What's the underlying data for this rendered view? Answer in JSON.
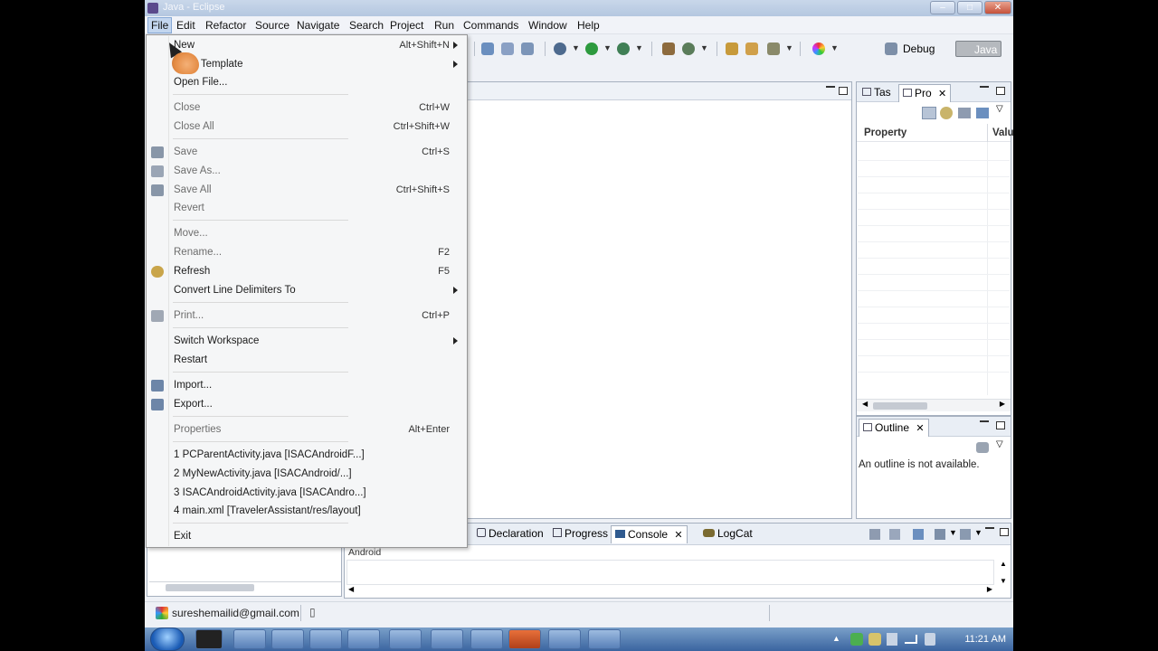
{
  "window": {
    "title": "Java - Eclipse"
  },
  "menubar": [
    "File",
    "Edit",
    "Refactor",
    "Source",
    "Navigate",
    "Search",
    "Project",
    "Run",
    "Commands",
    "Window",
    "Help"
  ],
  "perspectives": {
    "debug": "Debug",
    "java": "Java"
  },
  "file_menu": {
    "items": [
      {
        "label": "New",
        "shortcut": "Alt+Shift+N",
        "submenu": true
      },
      {
        "label": "From Template",
        "submenu": true
      },
      {
        "label": "Open File..."
      },
      {
        "label": "Close",
        "shortcut": "Ctrl+W"
      },
      {
        "label": "Close All",
        "shortcut": "Ctrl+Shift+W"
      },
      {
        "label": "Save",
        "shortcut": "Ctrl+S"
      },
      {
        "label": "Save As..."
      },
      {
        "label": "Save All",
        "shortcut": "Ctrl+Shift+S"
      },
      {
        "label": "Revert"
      },
      {
        "label": "Move..."
      },
      {
        "label": "Rename...",
        "shortcut": "F2"
      },
      {
        "label": "Refresh",
        "shortcut": "F5"
      },
      {
        "label": "Convert Line Delimiters To",
        "submenu": true
      },
      {
        "label": "Print...",
        "shortcut": "Ctrl+P"
      },
      {
        "label": "Switch Workspace",
        "submenu": true
      },
      {
        "label": "Restart"
      },
      {
        "label": "Import..."
      },
      {
        "label": "Export..."
      },
      {
        "label": "Properties",
        "shortcut": "Alt+Enter"
      },
      {
        "label": "1 PCParentActivity.java  [ISACAndroidF...]"
      },
      {
        "label": "2 MyNewActivity.java  [ISACAndroid/...]"
      },
      {
        "label": "3 ISACAndroidActivity.java  [ISACAndro...]"
      },
      {
        "label": "4 main.xml  [TravelerAssistant/res/layout]"
      },
      {
        "label": "Exit"
      }
    ]
  },
  "properties_view": {
    "tabs": [
      "Tas",
      "Pro"
    ],
    "columns": [
      "Property",
      "Valu"
    ]
  },
  "outline_view": {
    "tab": "Outline",
    "message": "An outline is not available."
  },
  "bottom_panel": {
    "tabs": [
      "Declaration",
      "Progress",
      "Console",
      "LogCat"
    ],
    "console_label": "Android"
  },
  "statusbar": {
    "account": "sureshemailid@gmail.com"
  },
  "taskbar": {
    "clock": "11:21 AM"
  }
}
